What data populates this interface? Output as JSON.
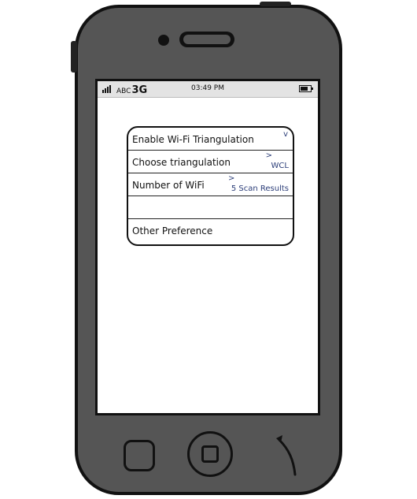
{
  "status_bar": {
    "carrier": "ABC",
    "network": "3G",
    "time": "03:49 PM"
  },
  "preferences": {
    "items": [
      {
        "label": "Enable Wi-Fi Triangulation",
        "indicator": "v",
        "value": ""
      },
      {
        "label": "Choose triangulation",
        "indicator": ">",
        "value": "WCL"
      },
      {
        "label": "Number of WiFi",
        "indicator": ">",
        "value": "5 Scan Results"
      },
      {
        "label": "",
        "indicator": "",
        "value": ""
      },
      {
        "label": "Other Preference",
        "indicator": "",
        "value": ""
      }
    ]
  },
  "colors": {
    "phone_body": "#555555",
    "status_bar_bg": "#e3e3e3",
    "value_text": "#2b3d78"
  },
  "icons": [
    "signal-bars-icon",
    "battery-icon",
    "camera-icon",
    "speaker-icon",
    "home-button-icon",
    "back-hook-icon"
  ]
}
